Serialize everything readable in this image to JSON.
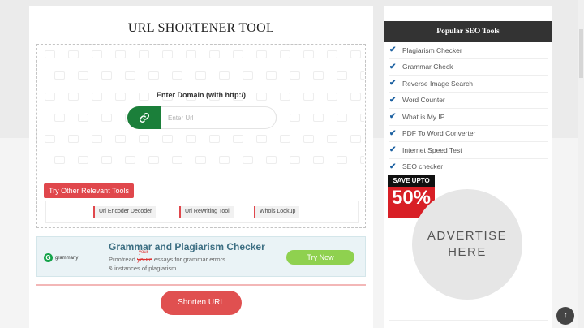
{
  "main": {
    "title": "URL SHORTENER TOOL",
    "domain_label": "Enter Domain (with http:/)",
    "url_placeholder": "Enter Url",
    "link_icon": "link-icon",
    "other_tools_label": "Try Other Relevant Tools",
    "tools": [
      {
        "label": "Url Encoder Decoder"
      },
      {
        "label": "Url Rewriting Tool"
      },
      {
        "label": "Whois Lookup"
      }
    ],
    "shorten_label": "Shorten URL"
  },
  "ad": {
    "brand": "grammarly",
    "title": "Grammar and Plagiarism Checker",
    "line1_prefix": "Proofread",
    "line1_struck": "youre",
    "line1_correction": "your",
    "line1_suffix": "essays for grammar errors",
    "line2": "& instances of plagiarism.",
    "button": "Try Now"
  },
  "sidebar": {
    "heading": "Popular SEO Tools",
    "items": [
      {
        "label": "Plagiarism Checker"
      },
      {
        "label": "Grammar Check"
      },
      {
        "label": "Reverse Image Search"
      },
      {
        "label": "Word Counter"
      },
      {
        "label": "What is My IP"
      },
      {
        "label": "PDF To Word Converter"
      },
      {
        "label": "Internet Speed Test"
      },
      {
        "label": "SEO checker"
      }
    ],
    "save_top": "SAVE UPTO",
    "save_pct": "50%",
    "advertise_line1": "ADVERTISE",
    "advertise_line2": "HERE"
  },
  "colors": {
    "accent_green": "#1b7f3a",
    "accent_red": "#e05050",
    "check_blue": "#1a5fa0"
  }
}
